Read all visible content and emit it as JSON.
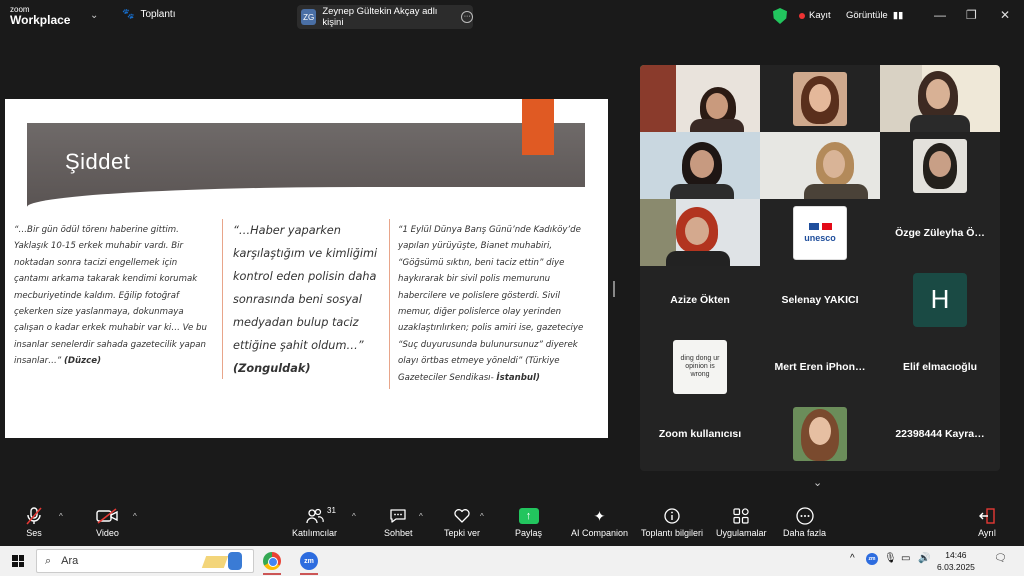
{
  "app": {
    "logo_line1": "zoom",
    "logo_line2": "Workplace",
    "meeting_tab": "Toplantı",
    "speaker": "Zeynep Gültekin Akçay adlı kişini",
    "speaker_initials": "ZG",
    "record_label": "Kayıt",
    "view_label": "Görüntüle"
  },
  "slide": {
    "title": "Şiddet",
    "quote1": "“…Bir gün ödül törenı haberine gittim. Yaklaşık 10-15 erkek muhabir vardı. Bir noktadan sonra tacizi engellemek için çantamı arkama takarak kendimi korumak mecburiyetinde kaldım. Eğilip fotoğraf çekerken size yaslanmaya, dokunmaya çalışan o kadar erkek muhabir var ki… Ve bu insanlar senelerdir sahada gazetecilik yapan insanlar…”",
    "quote1_src": "(Düzce)",
    "quote2": "“…Haber yaparken karşılaştığım ve kimliğimi kontrol eden polisin daha sonrasında beni sosyal medyadan bulup taciz ettiğine şahit oldum…”",
    "quote2_src": "(Zonguldak)",
    "quote3": "“1 Eylül Dünya Barış Günü’nde Kadıköy’de yapılan yürüyüşte, Bianet muhabiri, “Göğsümü sıktın, beni taciz ettin” diye haykırarak bir sivil polis memurunu habercilere ve polislere gösterdi. Sivil memur, diğer polislerce olay yerinden uzaklaştırılırken; polis amiri ise, gazeteciye “Suç duyurusunda bulunursunuz” diyerek olayı örtbas etmeye yöneldi” (Türkiye Gazeteciler Sendikası-",
    "quote3_src": "İstanbul)"
  },
  "gallery": {
    "names": {
      "ozge": "Özge Züleyha Ö…",
      "azize": "Azize Ökten",
      "selenay": "Selenay YAKICI",
      "mert": "Mert Eren iPhon…",
      "elif": "Elif elmacıoğlu",
      "zoom_user": "Zoom kullanıcısı",
      "kayra": "22398444 Kayra…"
    },
    "h_initial": "H",
    "unesco_text": "unesco",
    "sign_text": "ding dong ur opinion is wrong"
  },
  "toolbar": {
    "mute": "Ses",
    "video": "Video",
    "participants": "Katılımcılar",
    "participants_count": "31",
    "chat": "Sohbet",
    "react": "Tepki ver",
    "share": "Paylaş",
    "ai": "AI Companion",
    "info": "Toplantı bilgileri",
    "apps": "Uygulamalar",
    "more": "Daha fazla",
    "leave": "Ayrıl"
  },
  "taskbar": {
    "search": "Ara",
    "time": "14:46",
    "date": "6.03.2025"
  },
  "colors": {
    "accent_green": "#22c55e",
    "slide_orange": "#e05a23",
    "leave_red": "#e53935"
  }
}
